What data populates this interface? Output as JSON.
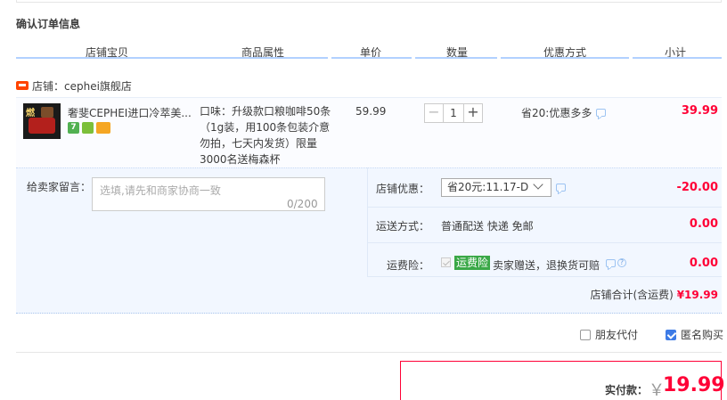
{
  "section_title": "确认订单信息",
  "columns": [
    "店铺宝贝",
    "商品属性",
    "单价",
    "数量",
    "优惠方式",
    "小计"
  ],
  "shop": {
    "label": "店铺：cephei旗舰店"
  },
  "item": {
    "title": "奢斐CEPHEI进口冷萃美...",
    "thumb_text": "燃",
    "badges": [
      "7",
      "",
      ""
    ],
    "property": "口味：升级款口粮咖啡50条（1g装，用100条包装介意勿拍，七天内发货）限量3000名送梅森杯",
    "price": "59.99",
    "quantity": "1",
    "qty_minus": "−",
    "qty_plus": "+",
    "discount": "省20:优惠多多",
    "subtotal": "39.99"
  },
  "message": {
    "label": "给卖家留言：",
    "placeholder": "选填,请先和商家协商一致",
    "counter": "0/200"
  },
  "shop_discount": {
    "label": "店铺优惠：",
    "selected": "省20元:11.17-D",
    "value": "-20.00"
  },
  "shipping": {
    "label": "运送方式：",
    "method": "普通配送 快递 免邮",
    "value": "0.00"
  },
  "shipping_insurance": {
    "label": "运费险：",
    "tag": "运费险",
    "text": "卖家赠送，退换货可赔",
    "help": "?",
    "value": "0.00"
  },
  "shop_total": {
    "label": "店铺合计(含运费)",
    "value": "¥19.99"
  },
  "options": {
    "friend_pay": "朋友代付",
    "friend_pay_checked": false,
    "anonymous": "匿名购买",
    "anonymous_checked": true
  },
  "payment": {
    "label": "实付款：",
    "currency": "￥",
    "amount": "19.99"
  },
  "colors": {
    "accent_red": "#ff0036",
    "header_rule": "#b2d1ff",
    "panel_bg": "#f2f7ff",
    "green_tag": "#3aa847"
  }
}
